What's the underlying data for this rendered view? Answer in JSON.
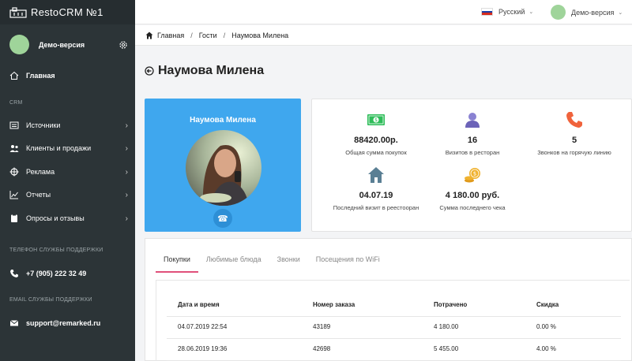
{
  "app": {
    "logo_text": "RestoCRM №1"
  },
  "sidebar": {
    "user_name": "Демо-версия",
    "home": "Главная",
    "crm_section": "CRM",
    "items": [
      {
        "label": "Источники",
        "icon": "list-icon"
      },
      {
        "label": "Клиенты и продажи",
        "icon": "users-icon"
      },
      {
        "label": "Реклама",
        "icon": "crosshair-icon"
      },
      {
        "label": "Отчеты",
        "icon": "chart-icon"
      },
      {
        "label": "Опросы и отзывы",
        "icon": "clipboard-icon"
      }
    ],
    "phone_section": "ТЕЛЕФОН СЛУЖБЫ ПОДДЕРЖКИ",
    "phone": "+7 (905) 222 32 49",
    "email_section": "EMAIL СЛУЖБЫ ПОДДЕРЖКИ",
    "email": "support@remarked.ru"
  },
  "topbar": {
    "language": "Русский",
    "user": "Демо-версия"
  },
  "breadcrumb": [
    "Главная",
    "Гости",
    "Наумова Милена"
  ],
  "page": {
    "title": "Наумова Милена"
  },
  "profile": {
    "name": "Наумова Милена"
  },
  "stats": [
    {
      "value": "88420.00р.",
      "label": "Общая сумма покупок",
      "icon": "money-icon",
      "color": "#2ebd59"
    },
    {
      "value": "16",
      "label": "Визитов в ресторан",
      "icon": "user-icon",
      "color": "#7a6fc7"
    },
    {
      "value": "5",
      "label": "Звонков на горячую линию",
      "icon": "phone-icon",
      "color": "#f0633c"
    },
    {
      "value": "04.07.19",
      "label": "Последний визит в реестооран",
      "icon": "house-icon",
      "color": "#5a7f94"
    },
    {
      "value": "4 180.00 руб.",
      "label": "Сумма последнего чека",
      "icon": "coins-icon",
      "color": "#f0b22f"
    }
  ],
  "tabs": [
    "Покупки",
    "Любимые блюда",
    "Звонки",
    "Посещения по WiFi"
  ],
  "table": {
    "headers": [
      "Дата и время",
      "Номер заказа",
      "Потрачено",
      "Скидка"
    ],
    "rows": [
      [
        "04.07.2019 22:54",
        "43189",
        "4 180.00",
        "0.00 %"
      ],
      [
        "28.06.2019 19:36",
        "42698",
        "5 455.00",
        "4.00 %"
      ]
    ]
  }
}
